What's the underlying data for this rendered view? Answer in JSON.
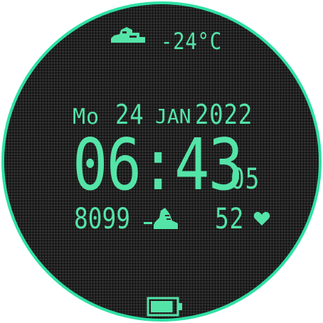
{
  "weather": {
    "icon": "cloud-icon",
    "temperature": "-24°C"
  },
  "date": {
    "day": "Mo",
    "day_num": "24",
    "month": "JAN",
    "year": "2022"
  },
  "time": {
    "hours_minutes": "06:43",
    "seconds": "05"
  },
  "activity": {
    "steps": "8099",
    "steps_icon": "shoe-icon",
    "heart_rate": "52",
    "heart_icon": "heart-icon"
  },
  "battery": {
    "icon": "battery-icon",
    "level": 0.9
  },
  "colors": {
    "accent": "#54e4a8",
    "ring": "#2fe0a6",
    "background": "#2e2e2e"
  }
}
